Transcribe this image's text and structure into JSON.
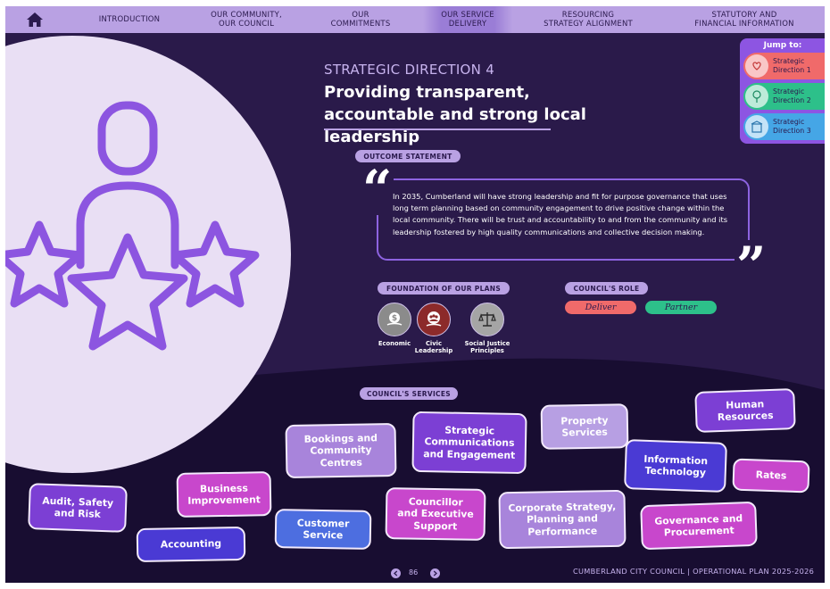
{
  "nav": {
    "tabs": [
      {
        "label": "INTRODUCTION"
      },
      {
        "label": "OUR COMMUNITY,\nOUR COUNCIL"
      },
      {
        "label": "OUR\nCOMMITMENTS"
      },
      {
        "label": "OUR SERVICE\nDELIVERY"
      },
      {
        "label": "RESOURCING\nSTRATEGY ALIGNMENT"
      },
      {
        "label": "STATUTORY AND\nFINANCIAL INFORMATION"
      }
    ],
    "active": "OUR SERVICE DELIVERY"
  },
  "heading": {
    "label": "STRATEGIC DIRECTION 4",
    "title": "Providing transparent, accountable and strong local leadership"
  },
  "jump": {
    "title": "Jump to:",
    "items": [
      {
        "label": "Strategic\nDirection 1",
        "color": "#f06a6a"
      },
      {
        "label": "Strategic\nDirection 2",
        "color": "#2dc08a"
      },
      {
        "label": "Strategic\nDirection 3",
        "color": "#45a6e6"
      }
    ]
  },
  "outcome": {
    "pill": "OUTCOME STATEMENT",
    "text": "In 2035, Cumberland will have strong leadership and fit for purpose governance that uses long term planning based on community engagement to drive positive change within the local community. There will be trust and accountability to and from the community and its leadership fostered by high quality communications and collective decision making."
  },
  "foundation": {
    "pill": "FOUNDATION OF OUR PLANS",
    "items": [
      {
        "label": "Economic",
        "color": "#8b8b8b"
      },
      {
        "label": "Civic\nLeadership",
        "color": "#8c2a2a"
      },
      {
        "label": "Social Justice\nPrinciples",
        "color": "#a5a5a5"
      }
    ]
  },
  "role": {
    "pill": "COUNCIL'S ROLE",
    "items": [
      {
        "label": "Deliver",
        "color": "#f06a6a"
      },
      {
        "label": "Partner",
        "color": "#2dc08a"
      }
    ]
  },
  "services": {
    "pill": "COUNCIL'S SERVICES",
    "items": [
      {
        "label": "Bookings and\nCommunity\nCentres"
      },
      {
        "label": "Strategic\nCommunications\nand Engagement"
      },
      {
        "label": "Property\nServices"
      },
      {
        "label": "Human\nResources"
      },
      {
        "label": "Information\nTechnology"
      },
      {
        "label": "Rates"
      },
      {
        "label": "Business\nImprovement"
      },
      {
        "label": "Audit, Safety\nand Risk"
      },
      {
        "label": "Councillor\nand Executive\nSupport"
      },
      {
        "label": "Corporate Strategy,\nPlanning and\nPerformance"
      },
      {
        "label": "Customer\nService"
      },
      {
        "label": "Accounting"
      },
      {
        "label": "Governance and\nProcurement"
      }
    ]
  },
  "footer": {
    "page": "86",
    "text": "CUMBERLAND CITY COUNCIL  |  OPERATIONAL PLAN 2025-2026"
  }
}
